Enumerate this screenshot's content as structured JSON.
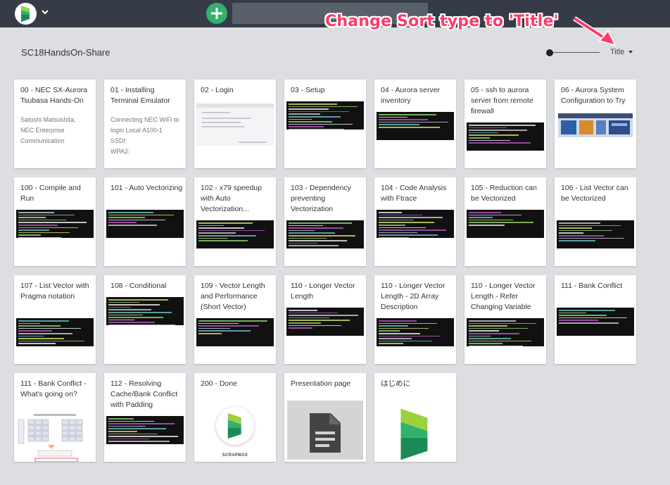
{
  "topbar": {
    "logo_icon": "scrapbox-logo-icon",
    "menu_icon": "chevron-down-icon",
    "add_icon": "plus-icon",
    "search_value": ""
  },
  "annotation": {
    "text": "Change Sort type to 'Title'",
    "color": "#ff3b6e"
  },
  "header": {
    "project_name": "SC18HandsOn-Share",
    "sort_label": "Title",
    "sort_icon": "chevron-down-icon"
  },
  "colors": {
    "topbar": "#363c47",
    "brand_green": "#32b16c",
    "page_bg": "#dddee1"
  },
  "cards": [
    {
      "title": "00 - NEC SX-Aurora Tsubasa Hands-On",
      "desc": [
        "Satoshi Matsushita,",
        "NEC Enterprise",
        "Communication"
      ],
      "thumb": "none"
    },
    {
      "title": "01 - Installing Terminal Emulator",
      "desc": [
        "Connecting NEC WiFi to",
        "login Local A100-1",
        "SSDI:",
        "WPA2:"
      ],
      "thumb": "none"
    },
    {
      "title": "02 - Login",
      "desc": [],
      "thumb": "browser"
    },
    {
      "title": "03 - Setup",
      "desc": [],
      "thumb": "terminal"
    },
    {
      "title": "04 - Aurora server inventory",
      "desc": [],
      "thumb": "terminal"
    },
    {
      "title": "05 - ssh to aurora server from remote firewall",
      "desc": [],
      "thumb": "terminal"
    },
    {
      "title": "06 - Aurora System Configuration to Try",
      "desc": [],
      "thumb": "aurora"
    },
    {
      "title": "100 - Compile and Run",
      "desc": [],
      "thumb": "terminal"
    },
    {
      "title": "101 - Auto Vectorizing",
      "desc": [],
      "thumb": "terminal"
    },
    {
      "title": "102 - x79 speedup with Auto Vectorization...",
      "desc": [],
      "thumb": "terminal"
    },
    {
      "title": "103 - Dependency preventing Vectorization",
      "desc": [],
      "thumb": "terminal"
    },
    {
      "title": "104 - Code Analysis with Ftrace",
      "desc": [],
      "thumb": "terminal"
    },
    {
      "title": "105 - Reduction can be Vectorized",
      "desc": [],
      "thumb": "terminal"
    },
    {
      "title": "106 - List Vector can be Vectorized",
      "desc": [],
      "thumb": "terminal"
    },
    {
      "title": "107 - List Vector with Pragma notation",
      "desc": [],
      "thumb": "terminal"
    },
    {
      "title": "108 - Conditional",
      "desc": [],
      "thumb": "terminal"
    },
    {
      "title": "109 - Vector Length and Performance (Short Vector)",
      "desc": [],
      "thumb": "terminal"
    },
    {
      "title": "110 - Longer Vector Length",
      "desc": [],
      "thumb": "terminal"
    },
    {
      "title": "110 - Longer Vector Length - 2D Array Description",
      "desc": [],
      "thumb": "terminal"
    },
    {
      "title": "110 - Longer Vector Length - Refer Changing Variable",
      "desc": [],
      "thumb": "terminal"
    },
    {
      "title": "111 - Bank Conflict",
      "desc": [],
      "thumb": "terminal"
    },
    {
      "title": "111 - Bank Conflict - What's going on?",
      "desc": [],
      "thumb": "diagram"
    },
    {
      "title": "112 - Resolving Cache/Bank Conflict with Padding",
      "desc": [],
      "thumb": "terminal"
    },
    {
      "title": "200 - Done",
      "desc": [],
      "thumb": "logo",
      "caption": "SCRAPBOX"
    },
    {
      "title": "Presentation page",
      "desc": [],
      "thumb": "document",
      "icon": "document-icon"
    },
    {
      "title": "はじめに",
      "desc": [],
      "thumb": "biglogo"
    }
  ]
}
